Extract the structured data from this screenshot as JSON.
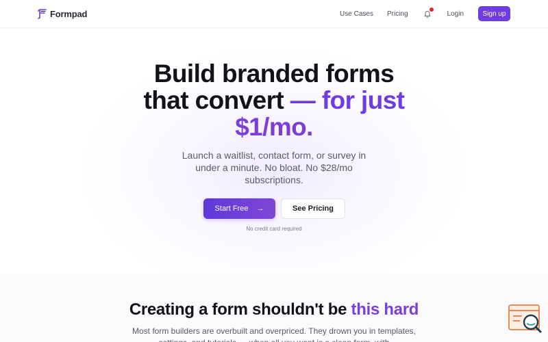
{
  "brand": {
    "name": "Formpad",
    "accent_color": "#6e3ce0",
    "logo_icon": "formpad-logo-icon"
  },
  "nav": {
    "links": [
      {
        "label": "Use Cases"
      },
      {
        "label": "Pricing"
      }
    ],
    "notification_icon": "bell-icon",
    "login_label": "Login",
    "signup_label": "Sign up"
  },
  "hero": {
    "title_line1": "Build branded forms",
    "title_line2_start": "that convert ",
    "title_line2_accent": "— for just",
    "title_line3_accent": "$1/mo.",
    "subtitle": "Launch a waitlist, contact form, or survey in under a minute. No bloat. No $28/mo subscriptions.",
    "primary_cta": "Start Free",
    "primary_cta_icon": "arrow-right-icon",
    "secondary_cta": "See Pricing",
    "note": "No credit card required"
  },
  "section2": {
    "title_start": "Creating a form shouldn't be ",
    "title_accent": "this hard",
    "body": "Most form builders are overbuilt and overpriced. They drown you in templates, settings, and tutorials — when all you want is a clean form, with"
  },
  "widget": {
    "icon": "form-search-widget-icon"
  }
}
